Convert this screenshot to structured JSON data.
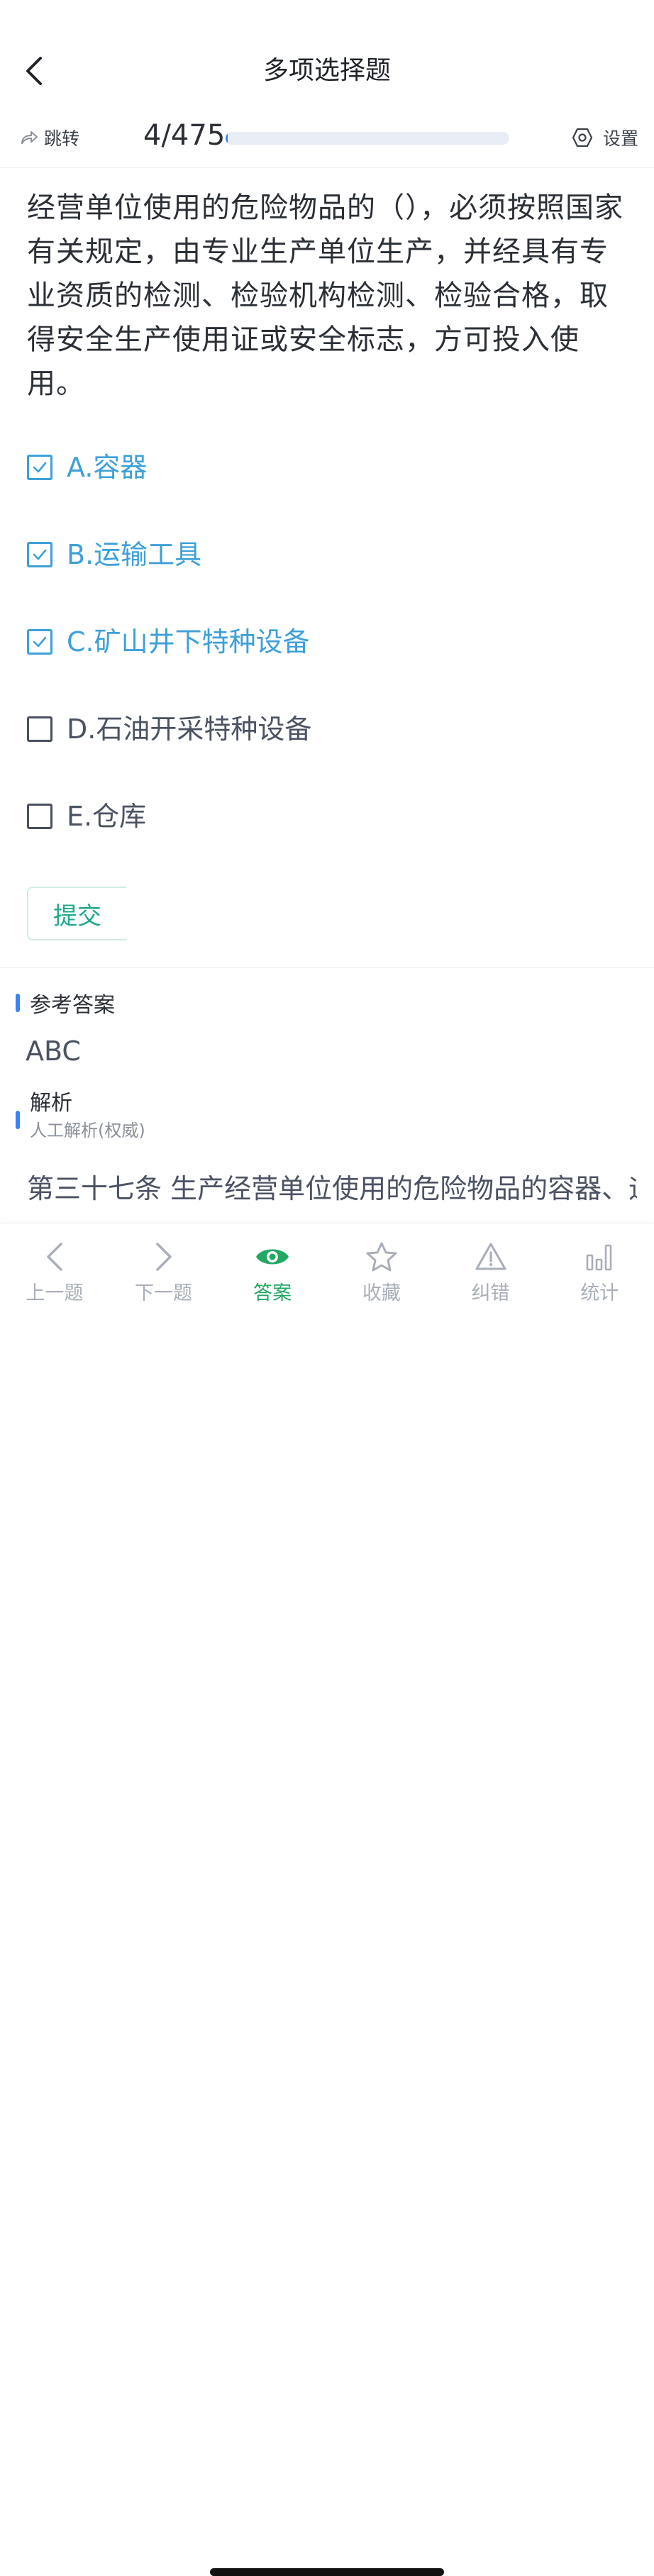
{
  "header": {
    "title": "多项选择题"
  },
  "progress": {
    "jump_label": "跳转",
    "counter": "4/475",
    "current": 4,
    "total": 475,
    "settings_label": "设置"
  },
  "question": {
    "text": "经营单位使用的危险物品的（），必须按照国家有关规定，由专业生产单位生产，并经具有专业资质的检测、检验机构检测、检验合格，取得安全生产使用证或安全标志，方可投入使用。",
    "options": [
      {
        "label": "A.容器",
        "checked": true
      },
      {
        "label": "B.运输工具",
        "checked": true
      },
      {
        "label": "C.矿山井下特种设备",
        "checked": true
      },
      {
        "label": "D.石油开采特种设备",
        "checked": false
      },
      {
        "label": "E.仓库",
        "checked": false
      }
    ],
    "submit_label": "提交"
  },
  "answer": {
    "title": "参考答案",
    "value": "ABC"
  },
  "analysis": {
    "title": "解析",
    "source": "人工解析(权威)",
    "text": "第三十七条 生产经营单位使用的危险物品的容器、运输工具，以及涉及人身安全、危险性较大的海洋"
  },
  "tabbar": {
    "items": [
      {
        "label": "上一题",
        "icon": "chevron-left-icon",
        "active": false
      },
      {
        "label": "下一题",
        "icon": "chevron-right-icon",
        "active": false
      },
      {
        "label": "答案",
        "icon": "eye-icon",
        "active": true
      },
      {
        "label": "收藏",
        "icon": "star-icon",
        "active": false
      },
      {
        "label": "纠错",
        "icon": "warning-icon",
        "active": false
      },
      {
        "label": "统计",
        "icon": "bar-chart-icon",
        "active": false
      }
    ]
  },
  "colors": {
    "accent_blue": "#3b82f6",
    "checked_option": "#3ea0d8",
    "submit_green": "#1fa98e",
    "active_tab": "#22a862",
    "inactive_tab": "#a9aeb8"
  }
}
